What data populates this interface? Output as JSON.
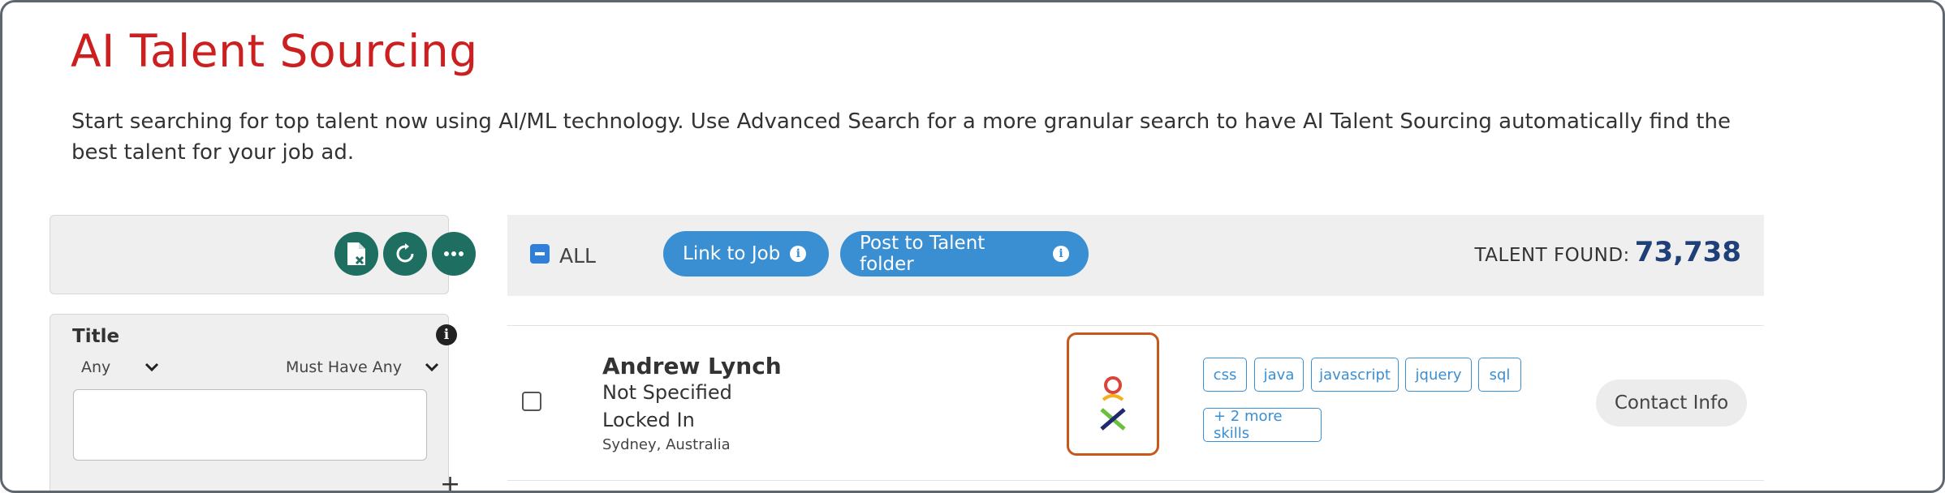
{
  "header": {
    "title": "AI Talent Sourcing",
    "description": "Start searching for top talent now using AI/ML technology. Use Advanced Search for a more granular search to have AI Talent Sourcing automatically find the best talent for your job ad."
  },
  "colors": {
    "title_red": "#cc1f1f",
    "accent_blue": "#3a8fd3",
    "dark_green": "#1e6f61",
    "count_navy": "#1f3f78",
    "highlight_orange": "#c8571b"
  },
  "sidebar": {
    "toolbar_icons": [
      "export-file-icon",
      "refresh-icon",
      "more-icon"
    ],
    "filter": {
      "label": "Title",
      "scope_value": "Any",
      "match_value": "Must Have Any",
      "text_value": ""
    }
  },
  "results": {
    "select_all_label": "ALL",
    "link_to_job_label": "Link to Job",
    "post_to_folder_label": "Post to Talent folder",
    "talent_found_label": "TALENT FOUND:",
    "talent_found_count": "73,738",
    "candidates": [
      {
        "name": "Andrew Lynch",
        "title": "Not Specified",
        "company": "Locked In",
        "location": "Sydney, Australia",
        "skills": [
          "css",
          "java",
          "javascript",
          "jquery",
          "sql"
        ],
        "more_skills": "+ 2 more skills",
        "contact_label": "Contact Info"
      }
    ]
  }
}
